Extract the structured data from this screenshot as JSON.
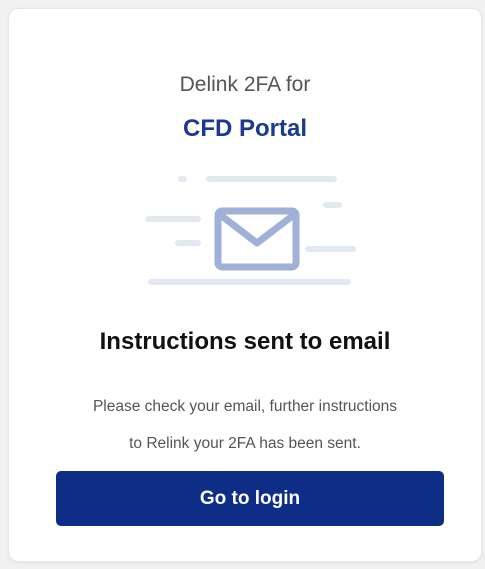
{
  "header": {
    "title_line1": "Delink 2FA for",
    "brand": "CFD Portal"
  },
  "illustration": {
    "icon": "envelope-icon",
    "accent_color": "#9fb1d6",
    "line_color": "#e4e8f2"
  },
  "main": {
    "title": "Instructions sent to email",
    "description_line1": "Please check your email, further instructions",
    "description_line2": "to Relink your 2FA has been sent."
  },
  "actions": {
    "login_label": "Go to login",
    "button_color": "#0d2d86"
  }
}
